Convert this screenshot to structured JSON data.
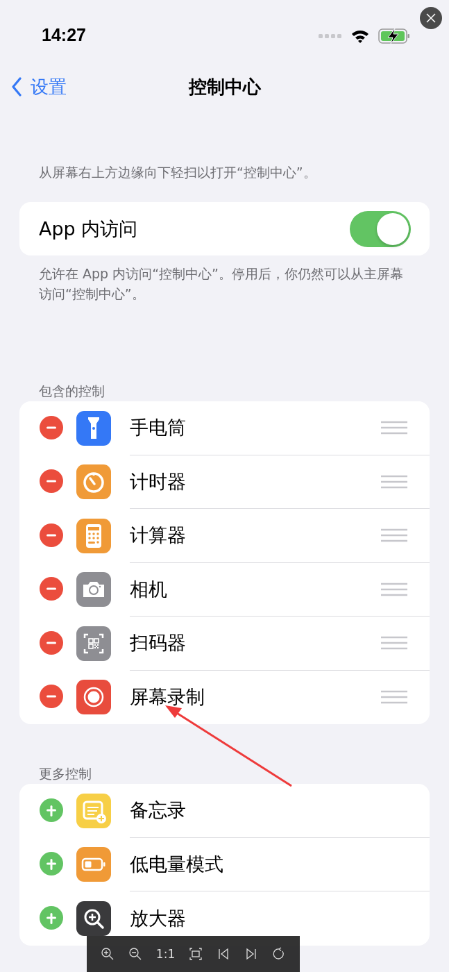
{
  "status_bar": {
    "time": "14:27"
  },
  "nav": {
    "back_label": "设置",
    "title": "控制中心"
  },
  "intro": "从屏幕右上方边缘向下轻扫以打开“控制中心”。",
  "access": {
    "label": "App 内访问",
    "on": true,
    "footer": "允许在 App 内访问“控制中心”。停用后，你仍然可以从主屏幕访问“控制中心”。"
  },
  "sections": [
    {
      "header": "包含的控制",
      "kind": "remove",
      "items": [
        {
          "label": "手电筒"
        },
        {
          "label": "计时器"
        },
        {
          "label": "计算器"
        },
        {
          "label": "相机"
        },
        {
          "label": "扫码器"
        },
        {
          "label": "屏幕录制"
        }
      ]
    },
    {
      "header": "更多控制",
      "kind": "add",
      "items": [
        {
          "label": "备忘录"
        },
        {
          "label": "低电量模式"
        },
        {
          "label": "放大器"
        }
      ]
    }
  ],
  "viewer_toolbar": {
    "zoom_label": "1:1"
  }
}
